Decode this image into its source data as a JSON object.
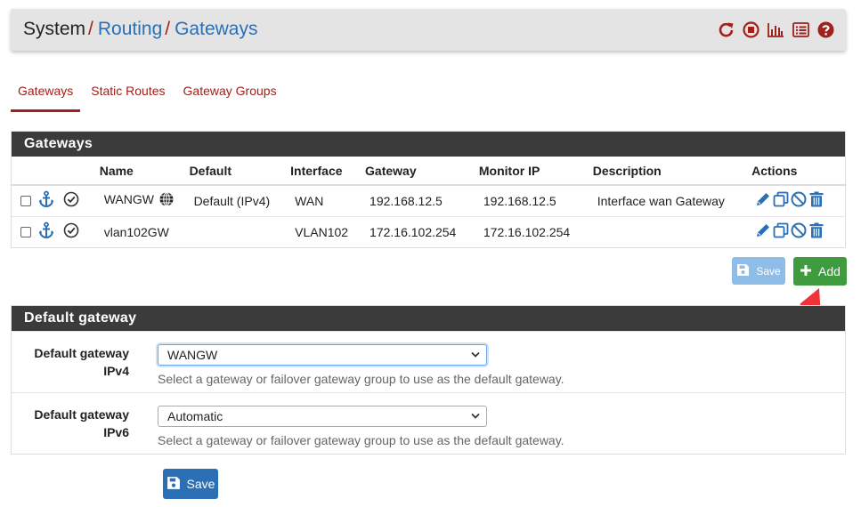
{
  "breadcrumb": {
    "root": "System",
    "sep": "/",
    "level1": "Routing",
    "level2": "Gateways"
  },
  "header_icons": [
    "reload-icon",
    "stop-icon",
    "chart-icon",
    "list-icon",
    "help-icon"
  ],
  "tabs": [
    {
      "label": "Gateways",
      "active": true
    },
    {
      "label": "Static Routes",
      "active": false
    },
    {
      "label": "Gateway Groups",
      "active": false
    }
  ],
  "gateways_panel": {
    "title": "Gateways",
    "columns": [
      "Name",
      "Default",
      "Interface",
      "Gateway",
      "Monitor IP",
      "Description",
      "Actions"
    ],
    "rows": [
      {
        "name": "WANGW",
        "default": "Default (IPv4)",
        "interface": "WAN",
        "gateway": "192.168.12.5",
        "monitor_ip": "192.168.12.5",
        "description": "Interface wan Gateway"
      },
      {
        "name": "vlan102GW",
        "default": "",
        "interface": "VLAN102",
        "gateway": "172.16.102.254",
        "monitor_ip": "172.16.102.254",
        "description": ""
      }
    ],
    "save_label": "Save",
    "add_label": "Add"
  },
  "default_gateway_panel": {
    "title": "Default gateway",
    "ipv4": {
      "label_line1": "Default gateway",
      "label_line2": "IPv4",
      "value": "WANGW",
      "help": "Select a gateway or failover gateway group to use as the default gateway."
    },
    "ipv6": {
      "label_line1": "Default gateway",
      "label_line2": "IPv6",
      "value": "Automatic",
      "help": "Select a gateway or failover gateway group to use as the default gateway."
    }
  },
  "save_button": "Save",
  "colors": {
    "brand_red": "#a0201a",
    "link_blue": "#2b6fb5",
    "panel_dark": "#3b3b3b",
    "success_green": "#3e9b3e",
    "primary_blue": "#2b6fb5",
    "arrow_red": "#f0323c"
  }
}
